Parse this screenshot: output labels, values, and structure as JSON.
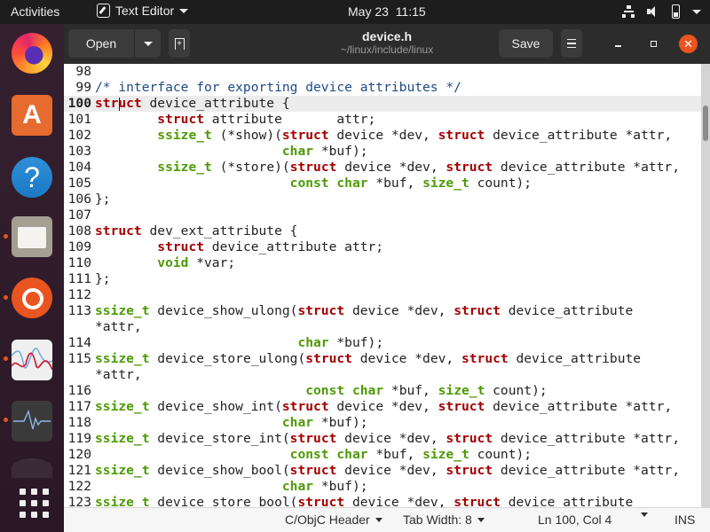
{
  "topbar": {
    "activities": "Activities",
    "app_name": "Text Editor",
    "clock": "May 23  11:15",
    "tray_icons": [
      "network-icon",
      "volume-icon",
      "battery-icon",
      "system-menu-caret"
    ]
  },
  "dock": {
    "items": [
      {
        "name": "Firefox",
        "icon": "firefox-icon",
        "running": false
      },
      {
        "name": "Ubuntu Software",
        "icon": "software-store-icon",
        "running": false
      },
      {
        "name": "Help",
        "icon": "help-icon",
        "glyph": "?",
        "running": false
      },
      {
        "name": "Files",
        "icon": "files-icon",
        "running": true
      },
      {
        "name": "Ubuntu",
        "icon": "ubuntu-icon",
        "running": true
      },
      {
        "name": "Resource Monitor",
        "icon": "graph-monitor-icon",
        "running": true
      },
      {
        "name": "System Monitor",
        "icon": "system-monitor-icon",
        "running": true
      },
      {
        "name": "Partially visible app",
        "icon": "partial-app-icon",
        "running": false
      },
      {
        "name": "Show Applications",
        "icon": "app-grid-icon",
        "running": false
      }
    ]
  },
  "header": {
    "open_label": "Open",
    "new_tab_glyph": "+",
    "title": "device.h",
    "subtitle": "~/linux/include/linux",
    "save_label": "Save",
    "close_glyph": "✕"
  },
  "editor": {
    "current_line": 100,
    "lines": [
      {
        "n": "98",
        "segs": []
      },
      {
        "n": "99",
        "segs": [
          [
            "cm",
            "/* interface for exporting device attributes */"
          ]
        ]
      },
      {
        "n": "100",
        "current": true,
        "segs": [
          [
            "kw",
            "struct"
          ],
          [
            "",
            " device_attribute {"
          ]
        ]
      },
      {
        "n": "101",
        "segs": [
          [
            "",
            "        "
          ],
          [
            "kw",
            "struct"
          ],
          [
            "",
            " attribute       attr;"
          ]
        ]
      },
      {
        "n": "102",
        "segs": [
          [
            "",
            "        "
          ],
          [
            "ty",
            "ssize_t"
          ],
          [
            "",
            " (*show)("
          ],
          [
            "kw",
            "struct"
          ],
          [
            "",
            " device *dev, "
          ],
          [
            "kw",
            "struct"
          ],
          [
            "",
            " device_attribute *attr,"
          ]
        ]
      },
      {
        "n": "103",
        "segs": [
          [
            "",
            "                        "
          ],
          [
            "ty",
            "char"
          ],
          [
            "",
            " *buf);"
          ]
        ]
      },
      {
        "n": "104",
        "segs": [
          [
            "",
            "        "
          ],
          [
            "ty",
            "ssize_t"
          ],
          [
            "",
            " (*store)("
          ],
          [
            "kw",
            "struct"
          ],
          [
            "",
            " device *dev, "
          ],
          [
            "kw",
            "struct"
          ],
          [
            "",
            " device_attribute *attr,"
          ]
        ]
      },
      {
        "n": "105",
        "segs": [
          [
            "",
            "                         "
          ],
          [
            "ty",
            "const"
          ],
          [
            "",
            " "
          ],
          [
            "ty",
            "char"
          ],
          [
            "",
            " *buf, "
          ],
          [
            "ty",
            "size_t"
          ],
          [
            "",
            " count);"
          ]
        ]
      },
      {
        "n": "106",
        "segs": [
          [
            "",
            "};"
          ]
        ]
      },
      {
        "n": "107",
        "segs": []
      },
      {
        "n": "108",
        "segs": [
          [
            "kw",
            "struct"
          ],
          [
            "",
            " dev_ext_attribute {"
          ]
        ]
      },
      {
        "n": "109",
        "segs": [
          [
            "",
            "        "
          ],
          [
            "kw",
            "struct"
          ],
          [
            "",
            " device_attribute attr;"
          ]
        ]
      },
      {
        "n": "110",
        "segs": [
          [
            "",
            "        "
          ],
          [
            "ty",
            "void"
          ],
          [
            "",
            " *var;"
          ]
        ]
      },
      {
        "n": "111",
        "segs": [
          [
            "",
            "};"
          ]
        ]
      },
      {
        "n": "112",
        "segs": []
      },
      {
        "n": "113",
        "segs": [
          [
            "ty",
            "ssize_t"
          ],
          [
            "",
            " device_show_ulong("
          ],
          [
            "kw",
            "struct"
          ],
          [
            "",
            " device *dev, "
          ],
          [
            "kw",
            "struct"
          ],
          [
            "",
            " device_attribute"
          ]
        ]
      },
      {
        "n": "",
        "segs": [
          [
            "",
            "*attr,"
          ]
        ]
      },
      {
        "n": "114",
        "segs": [
          [
            "",
            "                          "
          ],
          [
            "ty",
            "char"
          ],
          [
            "",
            " *buf);"
          ]
        ]
      },
      {
        "n": "115",
        "segs": [
          [
            "ty",
            "ssize_t"
          ],
          [
            "",
            " device_store_ulong("
          ],
          [
            "kw",
            "struct"
          ],
          [
            "",
            " device *dev, "
          ],
          [
            "kw",
            "struct"
          ],
          [
            "",
            " device_attribute"
          ]
        ]
      },
      {
        "n": "",
        "segs": [
          [
            "",
            "*attr,"
          ]
        ]
      },
      {
        "n": "116",
        "segs": [
          [
            "",
            "                           "
          ],
          [
            "ty",
            "const"
          ],
          [
            "",
            " "
          ],
          [
            "ty",
            "char"
          ],
          [
            "",
            " *buf, "
          ],
          [
            "ty",
            "size_t"
          ],
          [
            "",
            " count);"
          ]
        ]
      },
      {
        "n": "117",
        "segs": [
          [
            "ty",
            "ssize_t"
          ],
          [
            "",
            " device_show_int("
          ],
          [
            "kw",
            "struct"
          ],
          [
            "",
            " device *dev, "
          ],
          [
            "kw",
            "struct"
          ],
          [
            "",
            " device_attribute *attr,"
          ]
        ]
      },
      {
        "n": "118",
        "segs": [
          [
            "",
            "                        "
          ],
          [
            "ty",
            "char"
          ],
          [
            "",
            " *buf);"
          ]
        ]
      },
      {
        "n": "119",
        "segs": [
          [
            "ty",
            "ssize_t"
          ],
          [
            "",
            " device_store_int("
          ],
          [
            "kw",
            "struct"
          ],
          [
            "",
            " device *dev, "
          ],
          [
            "kw",
            "struct"
          ],
          [
            "",
            " device_attribute *attr,"
          ]
        ]
      },
      {
        "n": "120",
        "segs": [
          [
            "",
            "                         "
          ],
          [
            "ty",
            "const"
          ],
          [
            "",
            " "
          ],
          [
            "ty",
            "char"
          ],
          [
            "",
            " *buf, "
          ],
          [
            "ty",
            "size_t"
          ],
          [
            "",
            " count);"
          ]
        ]
      },
      {
        "n": "121",
        "segs": [
          [
            "ty",
            "ssize_t"
          ],
          [
            "",
            " device_show_bool("
          ],
          [
            "kw",
            "struct"
          ],
          [
            "",
            " device *dev, "
          ],
          [
            "kw",
            "struct"
          ],
          [
            "",
            " device_attribute *attr,"
          ]
        ]
      },
      {
        "n": "122",
        "segs": [
          [
            "",
            "                        "
          ],
          [
            "ty",
            "char"
          ],
          [
            "",
            " *buf);"
          ]
        ]
      },
      {
        "n": "123",
        "segs": [
          [
            "ty",
            "ssize_t"
          ],
          [
            "",
            " device_store_bool("
          ],
          [
            "kw",
            "struct"
          ],
          [
            "",
            " device *dev, "
          ],
          [
            "kw",
            "struct"
          ],
          [
            "",
            " device_attribute"
          ]
        ]
      }
    ]
  },
  "statusbar": {
    "language": "C/ObjC Header",
    "tab_width": "Tab Width: 8",
    "position": "Ln 100, Col 4",
    "mode": "INS"
  },
  "colors": {
    "accent": "#e95420",
    "keyword": "#a40000",
    "type": "#4e9a06",
    "comment": "#204a87"
  }
}
